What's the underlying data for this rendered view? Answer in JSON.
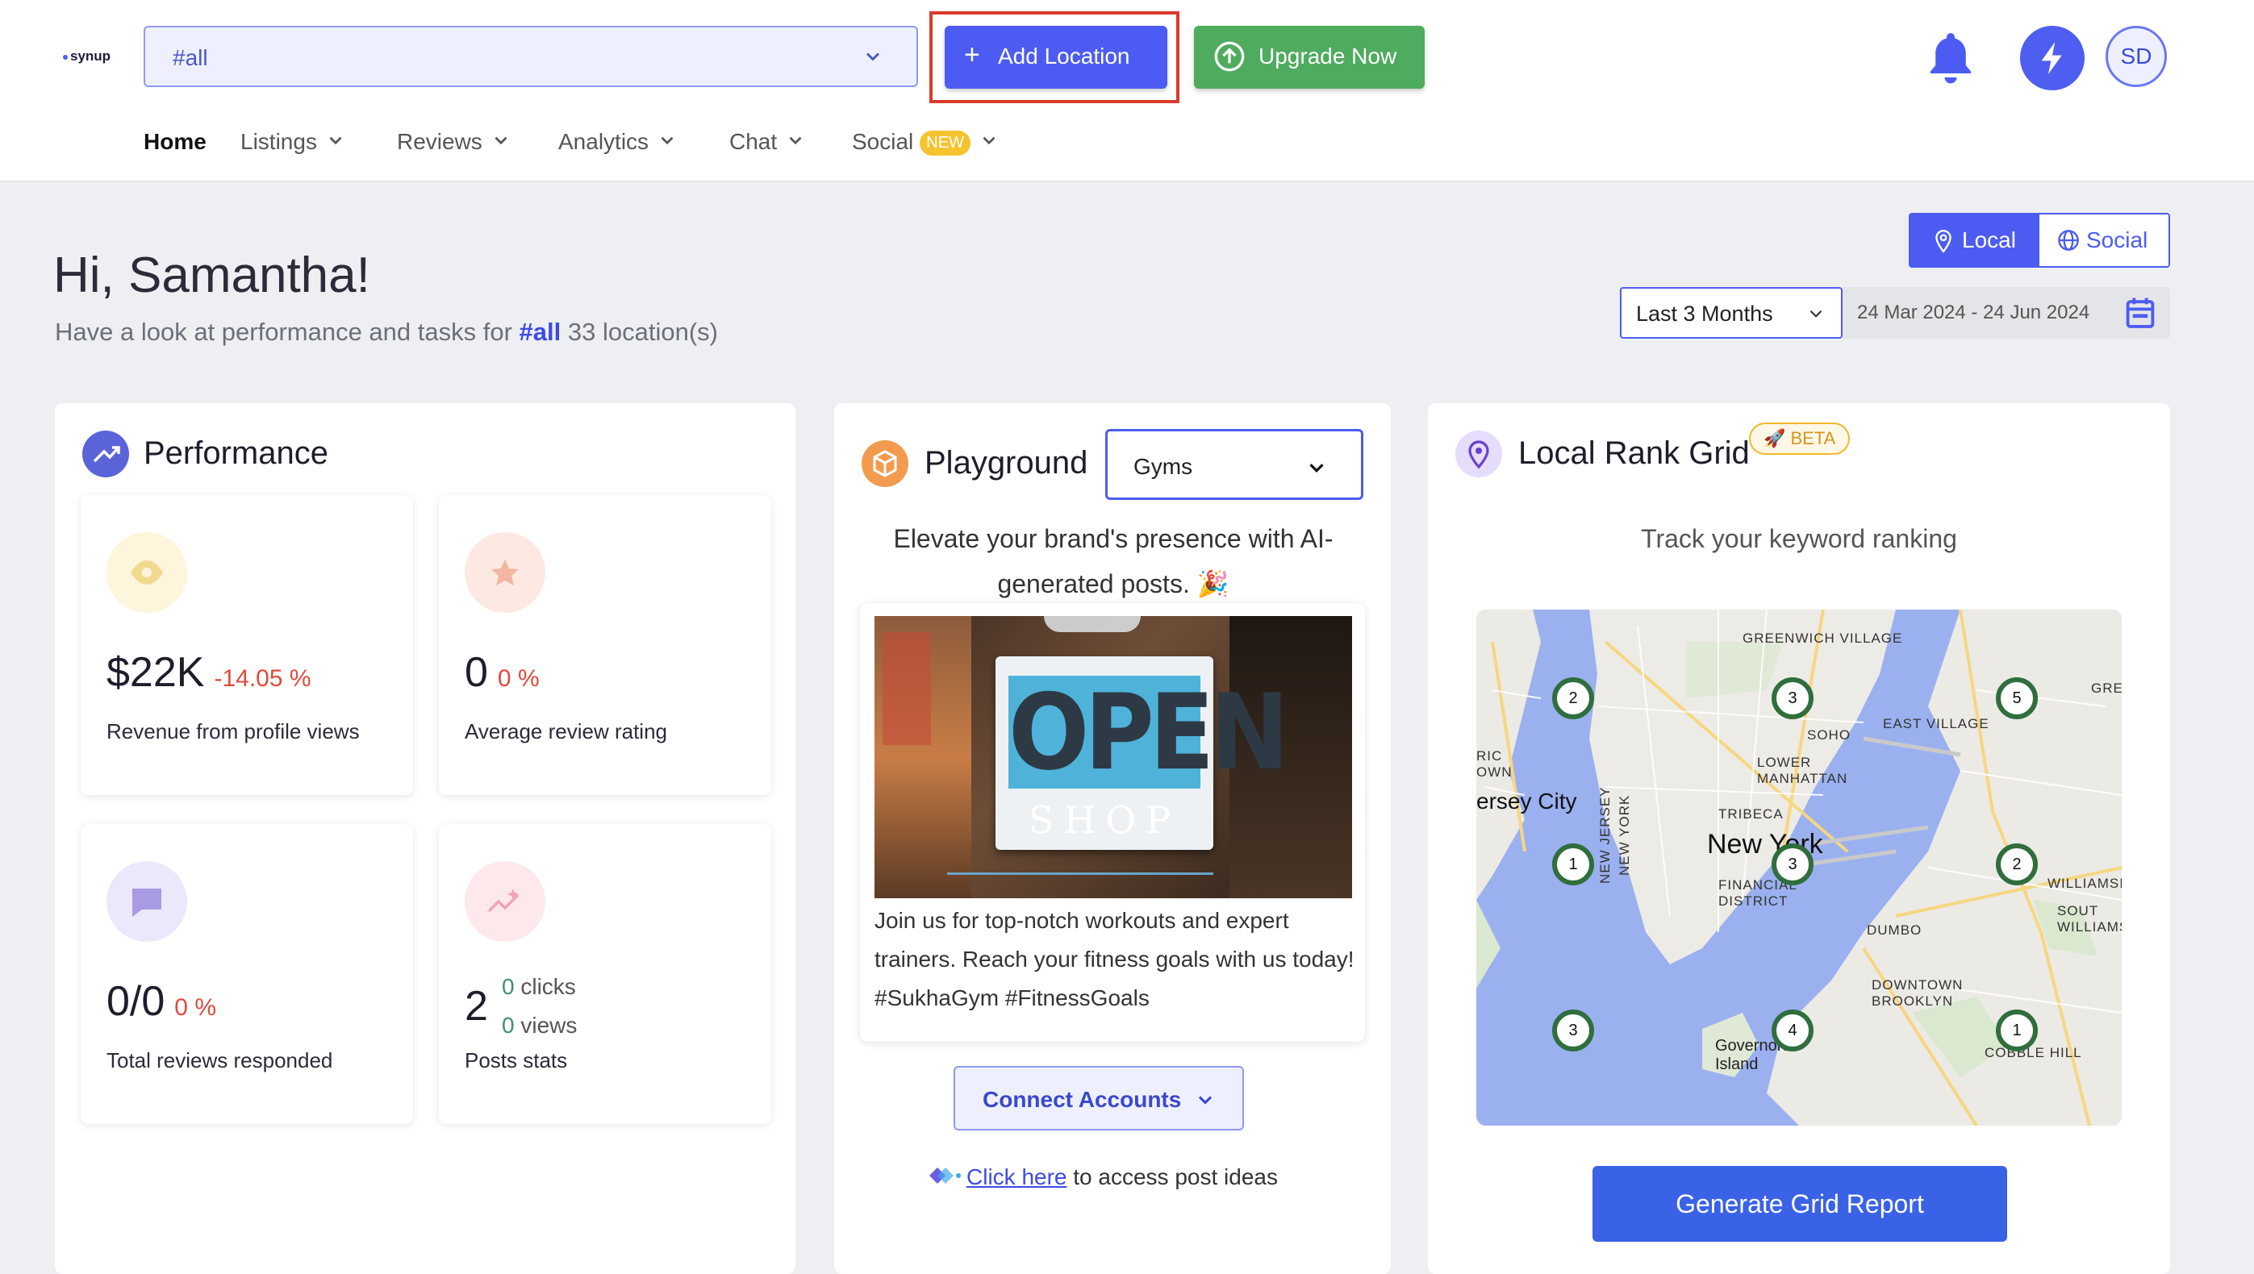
{
  "header": {
    "logo": "synup",
    "location_select": "#all",
    "add_location": "Add Location",
    "upgrade": "Upgrade Now",
    "avatar_initials": "SD",
    "icons": [
      "bell-icon",
      "bolt-icon"
    ]
  },
  "nav": {
    "home": "Home",
    "listings": "Listings",
    "reviews": "Reviews",
    "analytics": "Analytics",
    "chat": "Chat",
    "social": "Social",
    "social_badge": "NEW"
  },
  "hero": {
    "greeting": "Hi, Samantha!",
    "sub_prefix": "Have a look at performance and tasks for",
    "sub_tag": "#all",
    "sub_suffix": "33 location(s)"
  },
  "filters": {
    "local": "Local",
    "social": "Social",
    "range": "Last 3 Months",
    "dates": "24 Mar 2024 - 24 Jun 2024"
  },
  "performance": {
    "title": "Performance",
    "stats": [
      {
        "value": "$22K",
        "change": "-14.05 %",
        "label": "Revenue from profile views"
      },
      {
        "value": "0",
        "change": "0 %",
        "label": "Average review rating"
      },
      {
        "value": "0/0",
        "change": "0 %",
        "label": "Total reviews responded"
      },
      {
        "value": "2",
        "clicks": "0",
        "clicks_label": "clicks",
        "views": "0",
        "views_label": "views",
        "label": "Posts stats"
      }
    ]
  },
  "playground": {
    "title": "Playground",
    "category": "Gyms",
    "desc": "Elevate your brand's presence with AI-generated posts. 🎉",
    "sign_word": "OPEN",
    "sign_sub": "SHOP",
    "post_text": "Join us for top-notch workouts and expert trainers. Reach your fitness goals with us today! #SukhaGym #FitnessGoals",
    "connect": "Connect Accounts",
    "link": "Click here",
    "link_suffix": " to access post ideas"
  },
  "rank": {
    "title": "Local Rank Grid",
    "beta": "🚀 BETA",
    "subtitle": "Track your keyword ranking",
    "pins": [
      "2",
      "3",
      "5",
      "1",
      "3",
      "2",
      "3",
      "4",
      "1"
    ],
    "labels": {
      "greenwich": "GREENWICH VILLAGE",
      "soho": "SOHO",
      "lower": "LOWER MANHATTAN",
      "east": "EAST VILLAGE",
      "jersey": "ersey City",
      "newyork": "New York",
      "tribeca": "TRIBECA",
      "financial": "FINANCIAL DISTRICT",
      "dumbo": "DUMBO",
      "downtown": "DOWNTOWN BROOKLYN",
      "governors": "Governors Island",
      "williams": "WILLIAMSI",
      "southw": "SOUT WILLIAMS",
      "cobble": "COBBLE HILL",
      "gre": "GRE",
      "ric": "RIC OWN",
      "nj": "NEW JERSEY",
      "ny": "NEW YORK"
    },
    "generate": "Generate Grid Report"
  }
}
